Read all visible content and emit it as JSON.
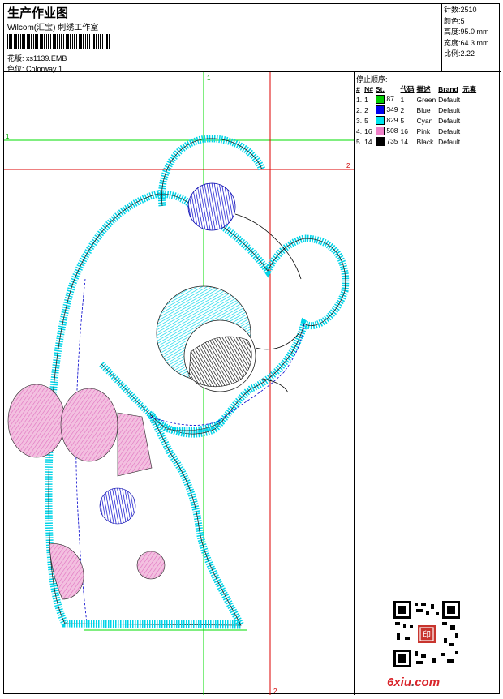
{
  "header": {
    "title": "生产作业图",
    "company": "Wilcom(汇宝) 刺绣工作室",
    "pattern_label": "花版:",
    "pattern_value": "xs1139.EMB",
    "colorway_label": "色位:",
    "colorway_value": "Colorway 1"
  },
  "stats": [
    {
      "label": "针数:",
      "value": "2510"
    },
    {
      "label": "颜色:",
      "value": "5"
    },
    {
      "label": "高度:",
      "value": "95.0 mm"
    },
    {
      "label": "宽度:",
      "value": "64.3 mm"
    },
    {
      "label": "比例:",
      "value": "2.22"
    }
  ],
  "sequence": {
    "title": "停止顺序:",
    "headers": [
      "#",
      "N#",
      "St.",
      "代码",
      "描述",
      "Brand",
      "元素"
    ],
    "rows": [
      {
        "idx": "1.",
        "n": "1",
        "st": "87",
        "code": "1",
        "desc": "Green",
        "brand": "Default",
        "color": "#00cc00"
      },
      {
        "idx": "2.",
        "n": "2",
        "st": "349",
        "code": "2",
        "desc": "Blue",
        "brand": "Default",
        "color": "#0000ee"
      },
      {
        "idx": "3.",
        "n": "5",
        "st": "829",
        "code": "5",
        "desc": "Cyan",
        "brand": "Default",
        "color": "#00e5ee"
      },
      {
        "idx": "4.",
        "n": "16",
        "st": "508",
        "code": "16",
        "desc": "Pink",
        "brand": "Default",
        "color": "#f080c8"
      },
      {
        "idx": "5.",
        "n": "14",
        "st": "735",
        "code": "14",
        "desc": "Black",
        "brand": "Default",
        "color": "#000000"
      }
    ]
  },
  "guides": {
    "green_v": "1",
    "green_h": "1",
    "red_h": "2",
    "red_v": "2"
  },
  "stamp_text": "印",
  "logo": {
    "main": "6xiu",
    "dot": ".",
    "tld": "com"
  }
}
